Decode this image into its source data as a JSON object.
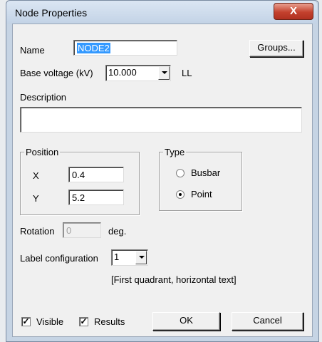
{
  "window": {
    "title": "Node Properties",
    "close_label": "X"
  },
  "name": {
    "label": "Name",
    "value": "NODE2"
  },
  "groups_button": "Groups...",
  "base_voltage": {
    "label": "Base voltage (kV)",
    "value": "10.000",
    "suffix": "LL"
  },
  "description": {
    "label": "Description",
    "value": ""
  },
  "position": {
    "title": "Position",
    "x_label": "X",
    "x_value": "0.4",
    "y_label": "Y",
    "y_value": "5.2"
  },
  "type": {
    "title": "Type",
    "options": [
      "Busbar",
      "Point"
    ],
    "selected": "Point"
  },
  "rotation": {
    "label": "Rotation",
    "value": "0",
    "unit": "deg."
  },
  "label_config": {
    "label": "Label configuration",
    "value": "1",
    "hint": "[First quadrant, horizontal text]"
  },
  "checkboxes": {
    "visible": "Visible",
    "results": "Results",
    "visible_checked": true,
    "results_checked": true
  },
  "buttons": {
    "ok": "OK",
    "cancel": "Cancel"
  }
}
